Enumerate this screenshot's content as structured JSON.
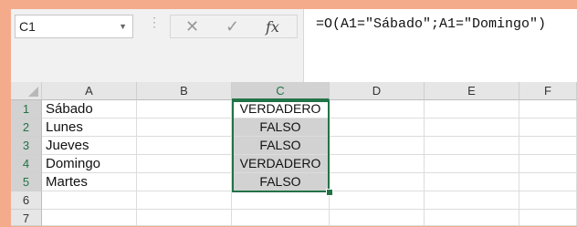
{
  "name_box": "C1",
  "formula_bar": {
    "cancel_icon": "✕",
    "enter_icon": "✓",
    "fx_label": "fx",
    "formula": "=O(A1=\"Sábado\";A1=\"Domingo\")"
  },
  "sheet": {
    "columns": [
      "A",
      "B",
      "C",
      "D",
      "E",
      "F"
    ],
    "selected_column": "C",
    "rows": [
      {
        "num": "1",
        "a": "Sábado",
        "c": "VERDADERO"
      },
      {
        "num": "2",
        "a": "Lunes",
        "c": "FALSO"
      },
      {
        "num": "3",
        "a": "Jueves",
        "c": "FALSO"
      },
      {
        "num": "4",
        "a": "Domingo",
        "c": "VERDADERO"
      },
      {
        "num": "5",
        "a": "Martes",
        "c": "FALSO"
      },
      {
        "num": "6",
        "a": "",
        "c": ""
      },
      {
        "num": "7",
        "a": "",
        "c": ""
      }
    ]
  },
  "accent_color": "#217346"
}
